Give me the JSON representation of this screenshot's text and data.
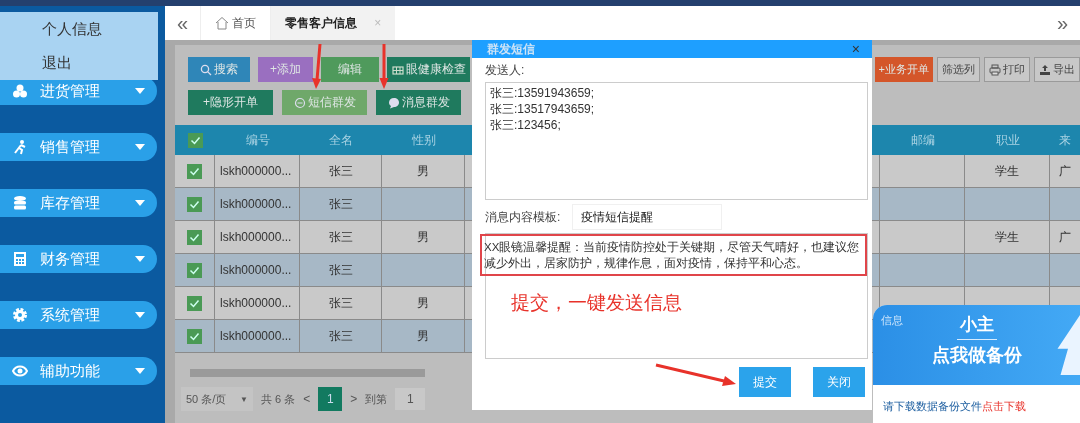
{
  "user_menu": {
    "items": [
      "个人信息",
      "退出"
    ]
  },
  "sidebar": {
    "items": [
      {
        "label": "进货管理"
      },
      {
        "label": "销售管理"
      },
      {
        "label": "库存管理"
      },
      {
        "label": "财务管理"
      },
      {
        "label": "系统管理"
      },
      {
        "label": "辅助功能"
      }
    ]
  },
  "tab_bar": {
    "collapse": "«",
    "expand": "»",
    "tabs": [
      {
        "label": "首页",
        "selected": false
      },
      {
        "label": "零售客户信息",
        "selected": true,
        "close": "×"
      }
    ]
  },
  "toolbar": {
    "row_1": [
      {
        "label": "搜索",
        "kind": "search",
        "color": "#2f86b8"
      },
      {
        "label": "+添加",
        "kind": "text",
        "color": "#9a6fc0"
      },
      {
        "label": "编辑",
        "kind": "text",
        "color": "#4f9a5c"
      },
      {
        "label": "眼健康检查",
        "kind": "grid",
        "color": "#1f7a5e"
      }
    ],
    "row_1_right": [
      {
        "label": "+业务开单",
        "kind": "text",
        "color": "#d4562a"
      },
      {
        "label": "筛选列",
        "kind": "text"
      },
      {
        "label": "打印",
        "kind": "print"
      },
      {
        "label": "导出",
        "kind": "export"
      }
    ],
    "row_2": [
      {
        "label": "+隐形开单",
        "kind": "text",
        "color": "#1f7a5e"
      },
      {
        "label": "短信群发",
        "kind": "sms",
        "color": "#6fa86a"
      },
      {
        "label": "消息群发",
        "kind": "chat",
        "color": "#1f7a5e"
      }
    ]
  },
  "table": {
    "header_checked": true,
    "columns": [
      "编号",
      "全名",
      "性别",
      "邮编",
      "职业",
      "来"
    ],
    "rows": [
      {
        "checked": true,
        "id": "lskh000000...",
        "name": "张三",
        "gender": "男",
        "occupation": "学生",
        "origin": "广"
      },
      {
        "checked": true,
        "id": "lskh000000...",
        "name": "张三"
      },
      {
        "checked": true,
        "id": "lskh000000...",
        "name": "张三",
        "gender": "男",
        "occupation": "学生",
        "origin": "广"
      },
      {
        "checked": true,
        "id": "lskh000000...",
        "name": "张三"
      },
      {
        "checked": true,
        "id": "lskh000000...",
        "name": "张三",
        "gender": "男"
      },
      {
        "checked": true,
        "id": "lskh000000...",
        "name": "张三",
        "gender": "男"
      }
    ]
  },
  "pagination": {
    "page_size": "50 条/页",
    "caret": "▼",
    "total": "共 6 条",
    "prev": "<",
    "current": "1",
    "next": ">",
    "goto_label": "到第",
    "goto_value": "1"
  },
  "dialog": {
    "title": "群发短信",
    "close": "×",
    "recipients_label": "发送人:",
    "recipients": [
      "张三:13591943659;",
      "张三:13517943659;",
      "张三:123456;"
    ],
    "template_label": "消息内容模板:",
    "template": "疫情短信提醒",
    "message": "XX眼镜温馨提醒：当前疫情防控处于关键期，尽管天气晴好，也建议您减少外出，居家防护，规律作息，面对疫情，保持平和心态。",
    "buttons": [
      "提交",
      "关闭"
    ]
  },
  "annotation": {
    "note": "提交，一键发送信息"
  },
  "backup_popup": {
    "tag": "信息",
    "title": "小主",
    "headline": "点我做备份",
    "text": "请下载数据备份文件",
    "link": "点击下载"
  }
}
